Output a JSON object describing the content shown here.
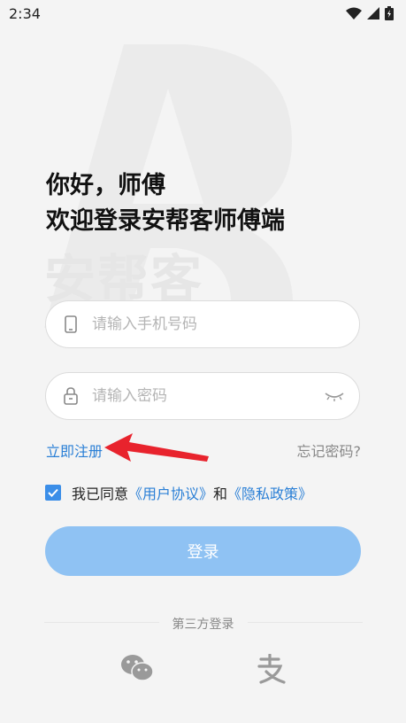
{
  "status_bar": {
    "time": "2:34"
  },
  "watermark": {
    "text": "安帮客"
  },
  "greeting": {
    "line1": "你好，师傅",
    "line2": "欢迎登录安帮客师傅端"
  },
  "phone_field": {
    "placeholder": "请输入手机号码",
    "value": ""
  },
  "password_field": {
    "placeholder": "请输入密码",
    "value": ""
  },
  "links": {
    "register": "立即注册",
    "forgot": "忘记密码?"
  },
  "agreement": {
    "prefix": "我已同意",
    "user_agreement": "《用户协议》",
    "and": "和",
    "privacy_policy": "《隐私政策》",
    "checked": true
  },
  "login_button": {
    "label": "登录"
  },
  "third_party": {
    "label": "第三方登录"
  },
  "colors": {
    "accent": "#2a7fd6",
    "button": "#8fc2f3",
    "arrow": "#e8232d"
  }
}
